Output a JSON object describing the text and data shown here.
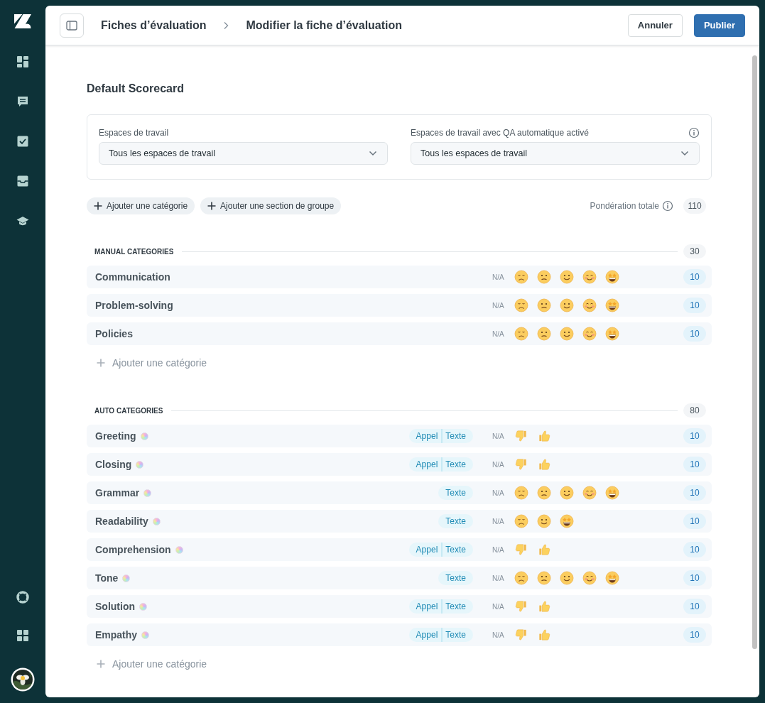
{
  "breadcrumbs": [
    "Fiches d’évaluation",
    "Modifier la fiche d’évaluation"
  ],
  "header_buttons": [
    {
      "label": "Annuler",
      "kind": "secondary"
    },
    {
      "label": "Publier",
      "kind": "primary"
    }
  ],
  "title": "Default Scorecard",
  "filters": [
    {
      "label": "Espaces de travail",
      "value": "Tous les espaces de travail",
      "info": false
    },
    {
      "label": "Espaces de travail avec QA automatique activé",
      "value": "Tous les espaces de travail",
      "info": true
    }
  ],
  "actions": [
    "Ajouter une catégorie",
    "Ajouter une section de groupe"
  ],
  "total_weight": {
    "label": "Pondération totale",
    "value": "110"
  },
  "sections": [
    {
      "title": "MANUAL CATEGORIES",
      "weight": "30",
      "add_label": "Ajouter une catégorie",
      "categories": [
        {
          "name": "Communication",
          "ai": false,
          "na": "N/A",
          "kind": "five",
          "weight": "10"
        },
        {
          "name": "Problem-solving",
          "ai": false,
          "na": "N/A",
          "kind": "five",
          "weight": "10"
        },
        {
          "name": "Policies",
          "ai": false,
          "na": "N/A",
          "kind": "five",
          "weight": "10"
        }
      ]
    },
    {
      "title": "AUTO CATEGORIES",
      "weight": "80",
      "add_label": "Ajouter une catégorie",
      "categories": [
        {
          "name": "Greeting",
          "ai": true,
          "channels": [
            "Appel",
            "Texte"
          ],
          "na": "N/A",
          "kind": "binary",
          "weight": "10"
        },
        {
          "name": "Closing",
          "ai": true,
          "channels": [
            "Appel",
            "Texte"
          ],
          "na": "N/A",
          "kind": "binary",
          "weight": "10"
        },
        {
          "name": "Grammar",
          "ai": true,
          "channels": [
            "Texte"
          ],
          "na": "N/A",
          "kind": "five",
          "weight": "10"
        },
        {
          "name": "Readability",
          "ai": true,
          "channels": [
            "Texte"
          ],
          "na": "N/A",
          "kind": "three",
          "weight": "10"
        },
        {
          "name": "Comprehension",
          "ai": true,
          "channels": [
            "Appel",
            "Texte"
          ],
          "na": "N/A",
          "kind": "binary",
          "weight": "10"
        },
        {
          "name": "Tone",
          "ai": true,
          "channels": [
            "Texte"
          ],
          "na": "N/A",
          "kind": "five",
          "weight": "10"
        },
        {
          "name": "Solution",
          "ai": true,
          "channels": [
            "Appel",
            "Texte"
          ],
          "na": "N/A",
          "kind": "binary",
          "weight": "10"
        },
        {
          "name": "Empathy",
          "ai": true,
          "channels": [
            "Appel",
            "Texte"
          ],
          "na": "N/A",
          "kind": "binary",
          "weight": "10"
        }
      ]
    }
  ]
}
